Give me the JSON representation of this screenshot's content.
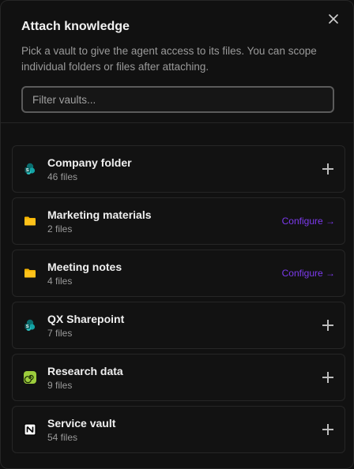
{
  "dialog": {
    "title": "Attach knowledge",
    "subtitle": "Pick a vault to give the agent access to its files. You can scope individual folders or files after attaching.",
    "close_icon": "close-icon"
  },
  "search": {
    "placeholder": "Filter vaults..."
  },
  "vaults": [
    {
      "name": "Company folder",
      "count": "46 files",
      "icon": "sharepoint-icon",
      "action": "add"
    },
    {
      "name": "Marketing materials",
      "count": "2 files",
      "icon": "folder-icon",
      "action": "configure",
      "action_label": "Configure →"
    },
    {
      "name": "Meeting notes",
      "count": "4 files",
      "icon": "folder-icon",
      "action": "configure",
      "action_label": "Configure →"
    },
    {
      "name": "QX Sharepoint",
      "count": "7 files",
      "icon": "sharepoint-icon",
      "action": "add"
    },
    {
      "name": "Research data",
      "count": "9 files",
      "icon": "spiral-icon",
      "action": "add"
    },
    {
      "name": "Service vault",
      "count": "54 files",
      "icon": "notion-icon",
      "action": "add"
    }
  ],
  "colors": {
    "accent": "#7c3aed",
    "folder": "#f5b400",
    "sharepoint": "#0f8b8d",
    "spiral": "#9ccc3c"
  }
}
